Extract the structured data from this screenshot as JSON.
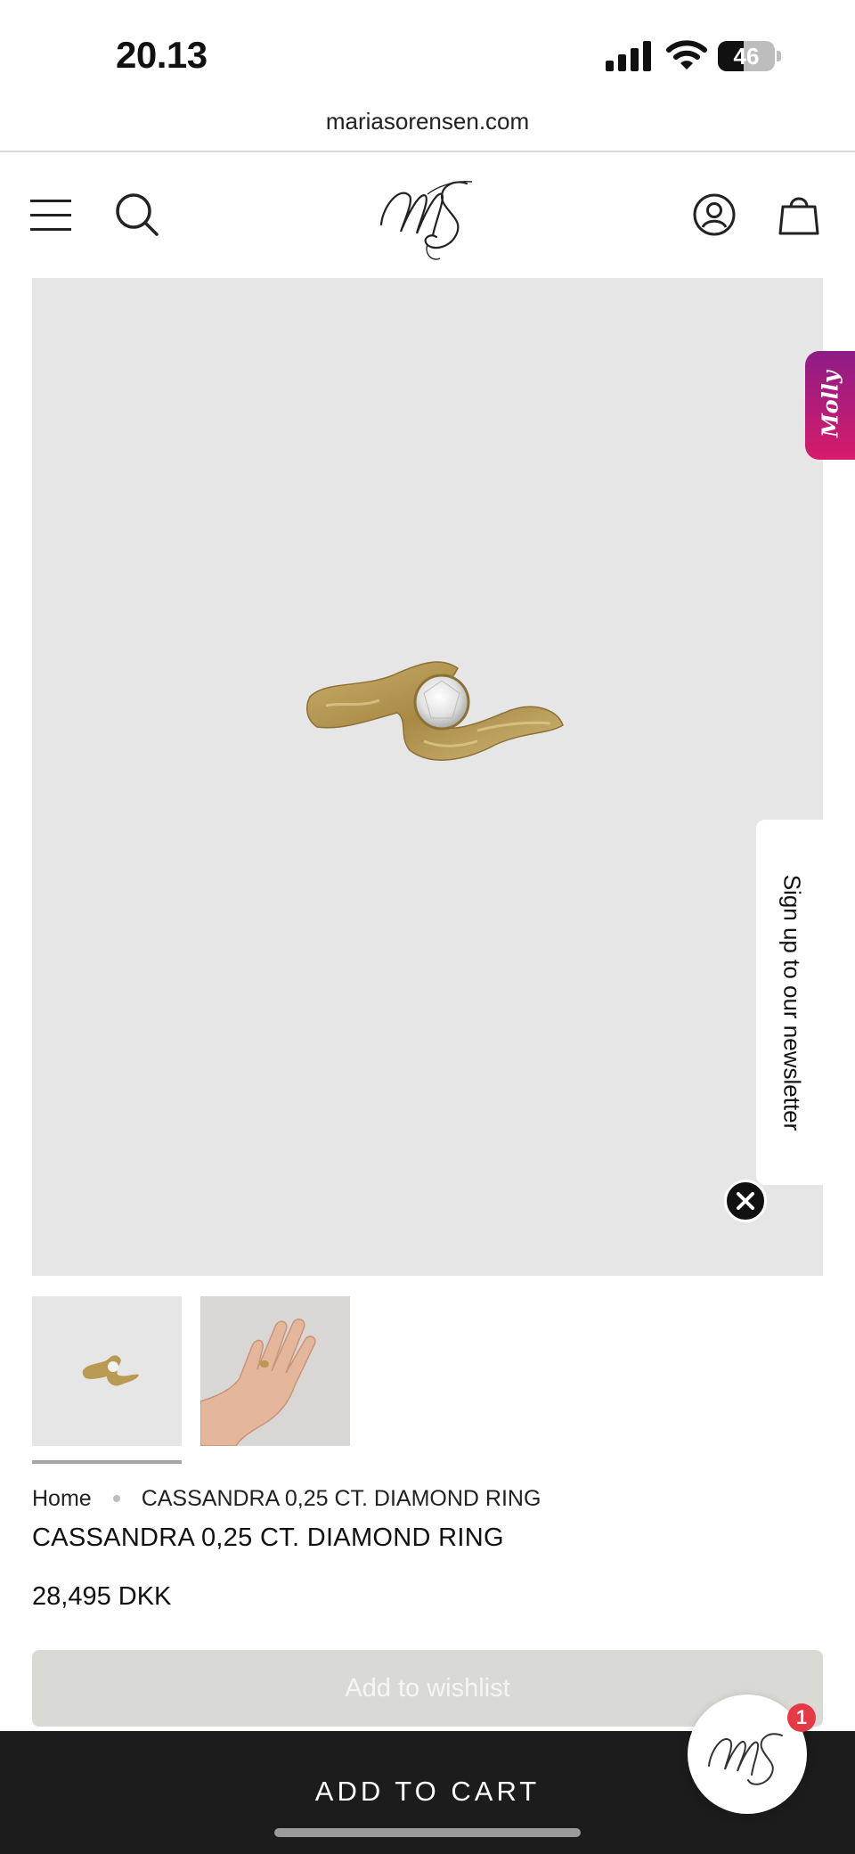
{
  "status_bar": {
    "time": "20.13",
    "battery_level": "46",
    "battery_fraction": 0.46
  },
  "browser": {
    "url": "mariasorensen.com"
  },
  "header": {
    "menu_icon": "hamburger-menu-icon",
    "search_icon": "search-icon",
    "logo_icon": "ms-monogram-logo",
    "account_icon": "account-icon",
    "cart_icon": "shopping-bag-icon"
  },
  "side_tabs": {
    "molly_label": "Molly",
    "newsletter_label": "Sign up to our newsletter",
    "newsletter_close_icon": "close-icon"
  },
  "breadcrumb": {
    "home": "Home",
    "current": "CASSANDRA 0,25 CT. DIAMOND RING"
  },
  "product": {
    "title": "CASSANDRA 0,25 CT. DIAMOND RING",
    "price": "28,495 DKK"
  },
  "actions": {
    "wishlist_label": "Add to wishlist",
    "add_to_cart_label": "ADD TO CART"
  },
  "chat": {
    "badge_count": "1"
  },
  "colors": {
    "image_bg": "#e6e6e6",
    "cart_bar": "#1c1c1c",
    "molly_gradient_start": "#8e1d86",
    "molly_gradient_end": "#d61b6a",
    "badge": "#e53946",
    "gold": "#b99a52"
  }
}
